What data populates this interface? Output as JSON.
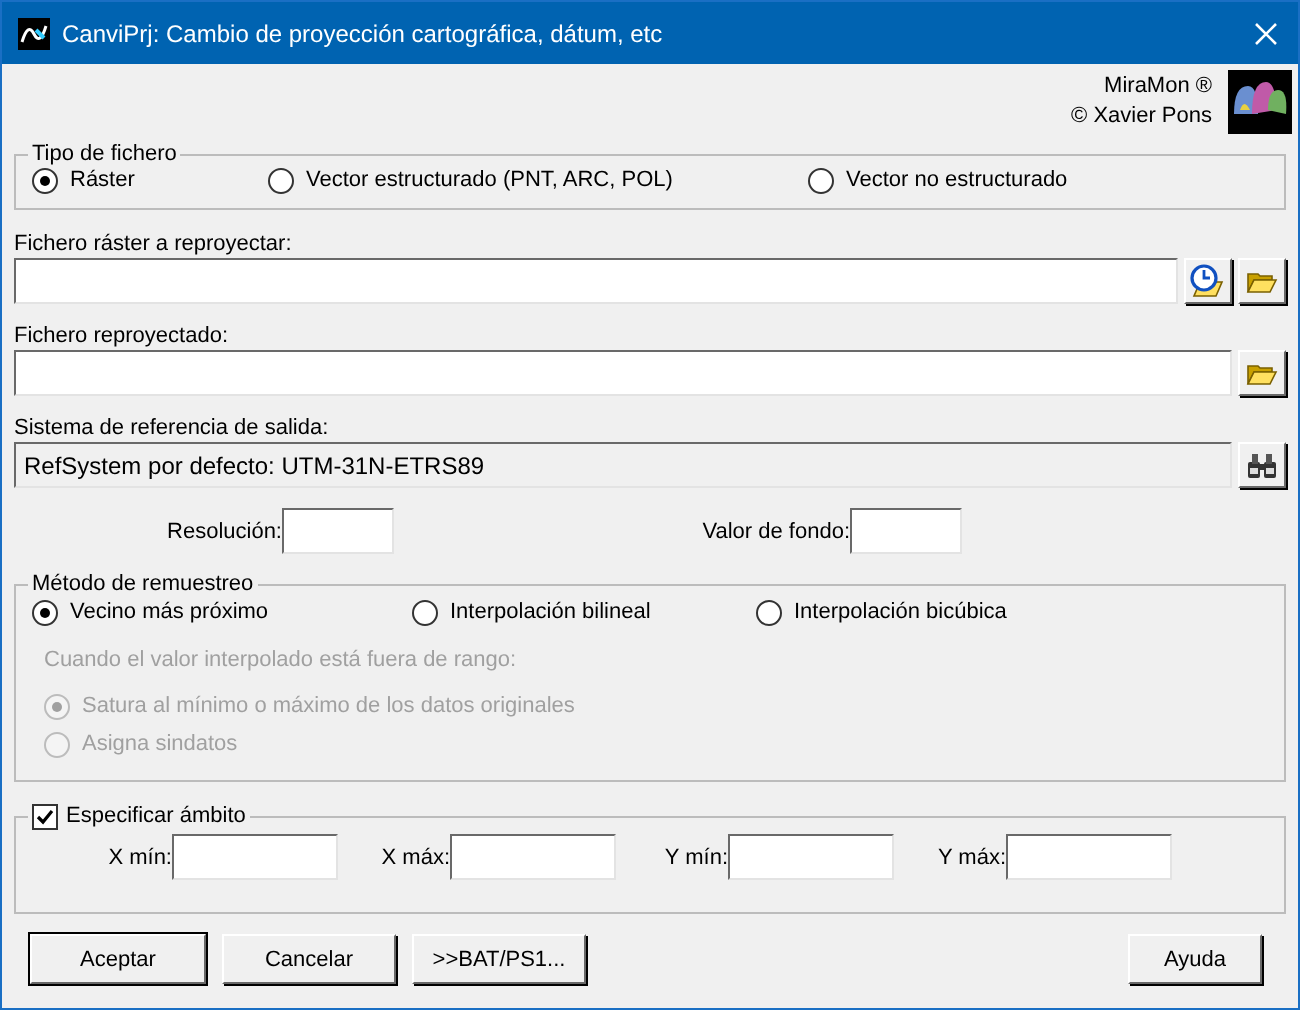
{
  "window": {
    "title": "CanviPrj: Cambio de proyección cartográfica, dátum, etc"
  },
  "brand": {
    "name": "MiraMon ®",
    "copyright": "© Xavier Pons"
  },
  "file_type": {
    "title": "Tipo de fichero",
    "options": [
      {
        "label": "Ráster",
        "selected": true
      },
      {
        "label": "Vector estructurado (PNT, ARC, POL)",
        "selected": false
      },
      {
        "label": "Vector no estructurado",
        "selected": false
      }
    ]
  },
  "input_file": {
    "label": "Fichero ráster a reproyectar:",
    "buttons": [
      {
        "kind": "recent"
      },
      {
        "kind": "browse"
      }
    ]
  },
  "output_file": {
    "label": "Fichero reproyectado:",
    "buttons": [
      {
        "kind": "browse"
      }
    ]
  },
  "reference_system": {
    "label": "Sistema de referencia de salida:",
    "value": "RefSystem por defecto: UTM-31N-ETRS89",
    "buttons": [
      {
        "kind": "find"
      }
    ]
  },
  "resolution": {
    "label": "Resolución:"
  },
  "background_value": {
    "label": "Valor de fondo:"
  },
  "resampling": {
    "title": "Método de remuestreo",
    "options": [
      {
        "label": "Vecino más próximo",
        "selected": true
      },
      {
        "label": "Interpolación bilineal",
        "selected": false
      },
      {
        "label": "Interpolación bicúbica",
        "selected": false
      }
    ],
    "out_of_range": {
      "disabled": true,
      "label": "Cuando el valor interpolado está fuera de rango:",
      "options": [
        {
          "label": "Satura al mínimo o máximo de los datos originales",
          "selected": true
        },
        {
          "label": "Asigna sindatos",
          "selected": false
        }
      ]
    }
  },
  "extent": {
    "label": "Especificar ámbito",
    "checked": true,
    "fields": [
      {
        "label": "X mín:"
      },
      {
        "label": "X máx:"
      },
      {
        "label": "Y mín:"
      },
      {
        "label": "Y máx:"
      }
    ]
  },
  "buttons": [
    {
      "label": "Aceptar",
      "default": true
    },
    {
      "label": "Cancelar",
      "default": false
    },
    {
      "label": ">>BAT/PS1...",
      "default": false
    }
  ],
  "help_button": {
    "label": "Ayuda",
    "default": false
  }
}
